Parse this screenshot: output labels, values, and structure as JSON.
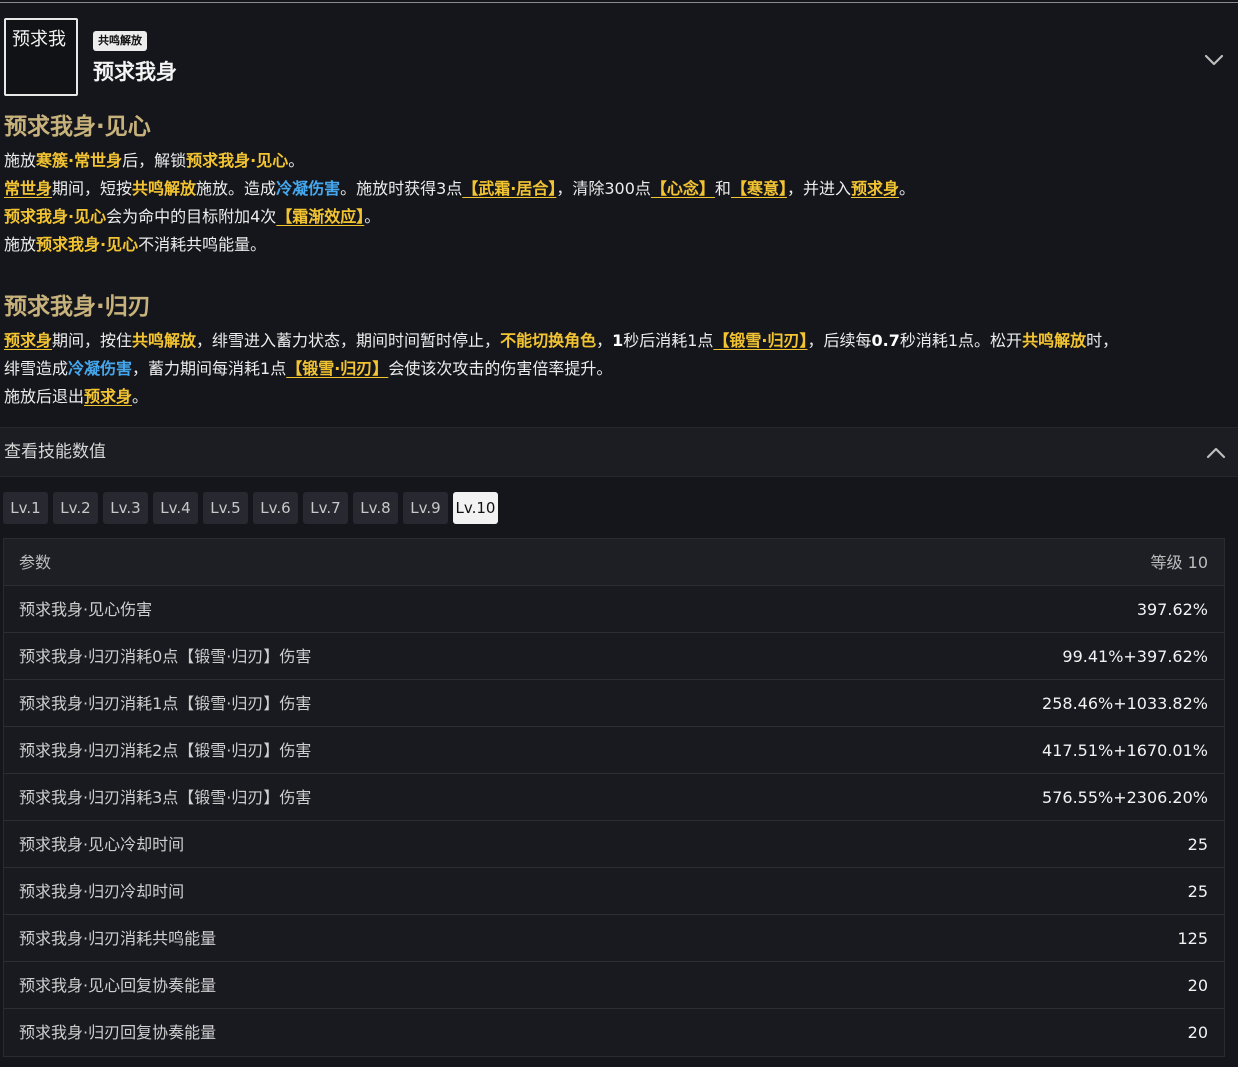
{
  "skill": {
    "icon_alt": "预求我",
    "badge": "共鸣解放",
    "title": "预求我身"
  },
  "sections": [
    {
      "title": "预求我身·见心",
      "lines": [
        [
          {
            "t": "施放",
            "s": "plain"
          },
          {
            "t": "寒簇·常世身",
            "s": "hl"
          },
          {
            "t": "后，解锁",
            "s": "plain"
          },
          {
            "t": "预求我身·见心",
            "s": "hl"
          },
          {
            "t": "。",
            "s": "plain"
          }
        ],
        [
          {
            "t": "常世身",
            "s": "kw"
          },
          {
            "t": "期间，短按",
            "s": "plain"
          },
          {
            "t": "共鸣解放",
            "s": "hl"
          },
          {
            "t": "施放。造成",
            "s": "plain"
          },
          {
            "t": "冷凝伤害",
            "s": "ice"
          },
          {
            "t": "。施放时获得3点",
            "s": "plain"
          },
          {
            "t": "【武霜·居合】",
            "s": "kw"
          },
          {
            "t": "，清除300点",
            "s": "plain"
          },
          {
            "t": "【心念】",
            "s": "kw"
          },
          {
            "t": "和",
            "s": "plain"
          },
          {
            "t": "【寒意】",
            "s": "kw"
          },
          {
            "t": "，并进入",
            "s": "plain"
          },
          {
            "t": "预求身",
            "s": "kw"
          },
          {
            "t": "。",
            "s": "plain"
          }
        ],
        [
          {
            "t": "预求我身·见心",
            "s": "hl"
          },
          {
            "t": "会为命中的目标附加4次",
            "s": "plain"
          },
          {
            "t": "【霜渐效应】",
            "s": "kw"
          },
          {
            "t": "。",
            "s": "plain"
          }
        ],
        [
          {
            "t": "施放",
            "s": "plain"
          },
          {
            "t": "预求我身·见心",
            "s": "hl"
          },
          {
            "t": "不消耗共鸣能量。",
            "s": "plain"
          }
        ]
      ]
    },
    {
      "title": "预求我身·归刃",
      "lines": [
        [
          {
            "t": "预求身",
            "s": "kw"
          },
          {
            "t": "期间，按住",
            "s": "plain"
          },
          {
            "t": "共鸣解放",
            "s": "hl"
          },
          {
            "t": "，绯雪进入蓄力状态，期间时间暂时停止，",
            "s": "plain"
          },
          {
            "t": "不能切换角色",
            "s": "hl"
          },
          {
            "t": "，",
            "s": "plain"
          },
          {
            "t": "1",
            "s": "bold"
          },
          {
            "t": "秒后消耗1点",
            "s": "plain"
          },
          {
            "t": "【锻雪·归刃】",
            "s": "kw"
          },
          {
            "t": "，后续每",
            "s": "plain"
          },
          {
            "t": "0.7",
            "s": "bold"
          },
          {
            "t": "秒消耗1点。松开",
            "s": "plain"
          },
          {
            "t": "共鸣解放",
            "s": "hl"
          },
          {
            "t": "时，",
            "s": "plain"
          }
        ],
        [
          {
            "t": "绯雪造成",
            "s": "plain"
          },
          {
            "t": "冷凝伤害",
            "s": "ice"
          },
          {
            "t": "，蓄力期间每消耗1点",
            "s": "plain"
          },
          {
            "t": "【锻雪·归刃】",
            "s": "kw"
          },
          {
            "t": "会使该次攻击的伤害倍率提升。",
            "s": "plain"
          }
        ],
        [
          {
            "t": "施放后退出",
            "s": "plain"
          },
          {
            "t": "预求身",
            "s": "kw"
          },
          {
            "t": "。",
            "s": "plain"
          }
        ]
      ]
    }
  ],
  "values_toggle": {
    "label": "查看技能数值"
  },
  "levels": [
    "Lv.1",
    "Lv.2",
    "Lv.3",
    "Lv.4",
    "Lv.5",
    "Lv.6",
    "Lv.7",
    "Lv.8",
    "Lv.9",
    "Lv.10"
  ],
  "active_level": "Lv.10",
  "table": {
    "header": {
      "param": "参数",
      "level": "等级 10"
    },
    "rows": [
      {
        "name": "预求我身·见心伤害",
        "value": "397.62%"
      },
      {
        "name": "预求我身·归刃消耗0点【锻雪·归刃】伤害",
        "value": "99.41%+397.62%"
      },
      {
        "name": "预求我身·归刃消耗1点【锻雪·归刃】伤害",
        "value": "258.46%+1033.82%"
      },
      {
        "name": "预求我身·归刃消耗2点【锻雪·归刃】伤害",
        "value": "417.51%+1670.01%"
      },
      {
        "name": "预求我身·归刃消耗3点【锻雪·归刃】伤害",
        "value": "576.55%+2306.20%"
      },
      {
        "name": "预求我身·见心冷却时间",
        "value": "25"
      },
      {
        "name": "预求我身·归刃冷却时间",
        "value": "25"
      },
      {
        "name": "预求我身·归刃消耗共鸣能量",
        "value": "125"
      },
      {
        "name": "预求我身·见心回复协奏能量",
        "value": "20"
      },
      {
        "name": "预求我身·归刃回复协奏能量",
        "value": "20"
      }
    ]
  },
  "colors": {
    "section_title": "#c8b27c",
    "highlight": "#f3c431",
    "ice": "#45a8ee",
    "background": "#15161b"
  },
  "icons": [
    "chevron-down-icon",
    "chevron-up-icon"
  ]
}
